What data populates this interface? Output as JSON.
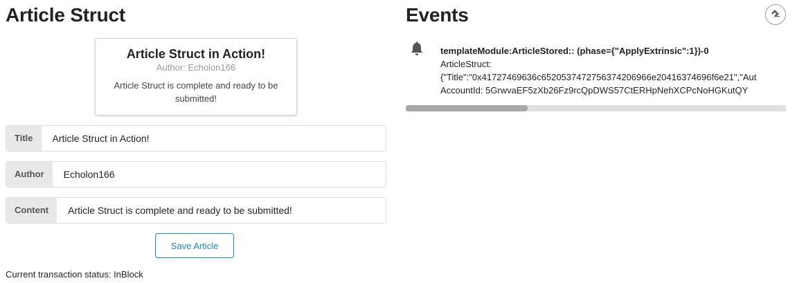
{
  "article": {
    "title": "Article Struct",
    "card": {
      "header": "Article Struct in Action!",
      "meta": "Author: Echolon166",
      "description": "Article Struct is complete and ready to be submitted!"
    },
    "fields": {
      "title_label": "Title",
      "title_value": "Article Struct in Action!",
      "author_label": "Author",
      "author_value": "Echolon166",
      "content_label": "Content",
      "content_value": "Article Struct is complete and ready to be submitted!"
    },
    "save_label": "Save Article",
    "status": "Current transaction status: InBlock"
  },
  "events": {
    "title": "Events",
    "clear_icon": "eraser-icon",
    "items": [
      {
        "icon": "bell-icon",
        "summary": "templateModule:ArticleStored:: (phase={\"ApplyExtrinsic\":1})-0",
        "line1": "ArticleStruct:",
        "line2": "{\"Title\":\"0x41727469636c6520537472756374206966e20416374696f6e21\",\"Aut",
        "line3": "AccountId: 5GrwvaEF5zXb26Fz9rcQpDWS57CtERHpNehXCPcNoHGKutQY"
      }
    ],
    "scrollbar_fraction": 0.32
  }
}
